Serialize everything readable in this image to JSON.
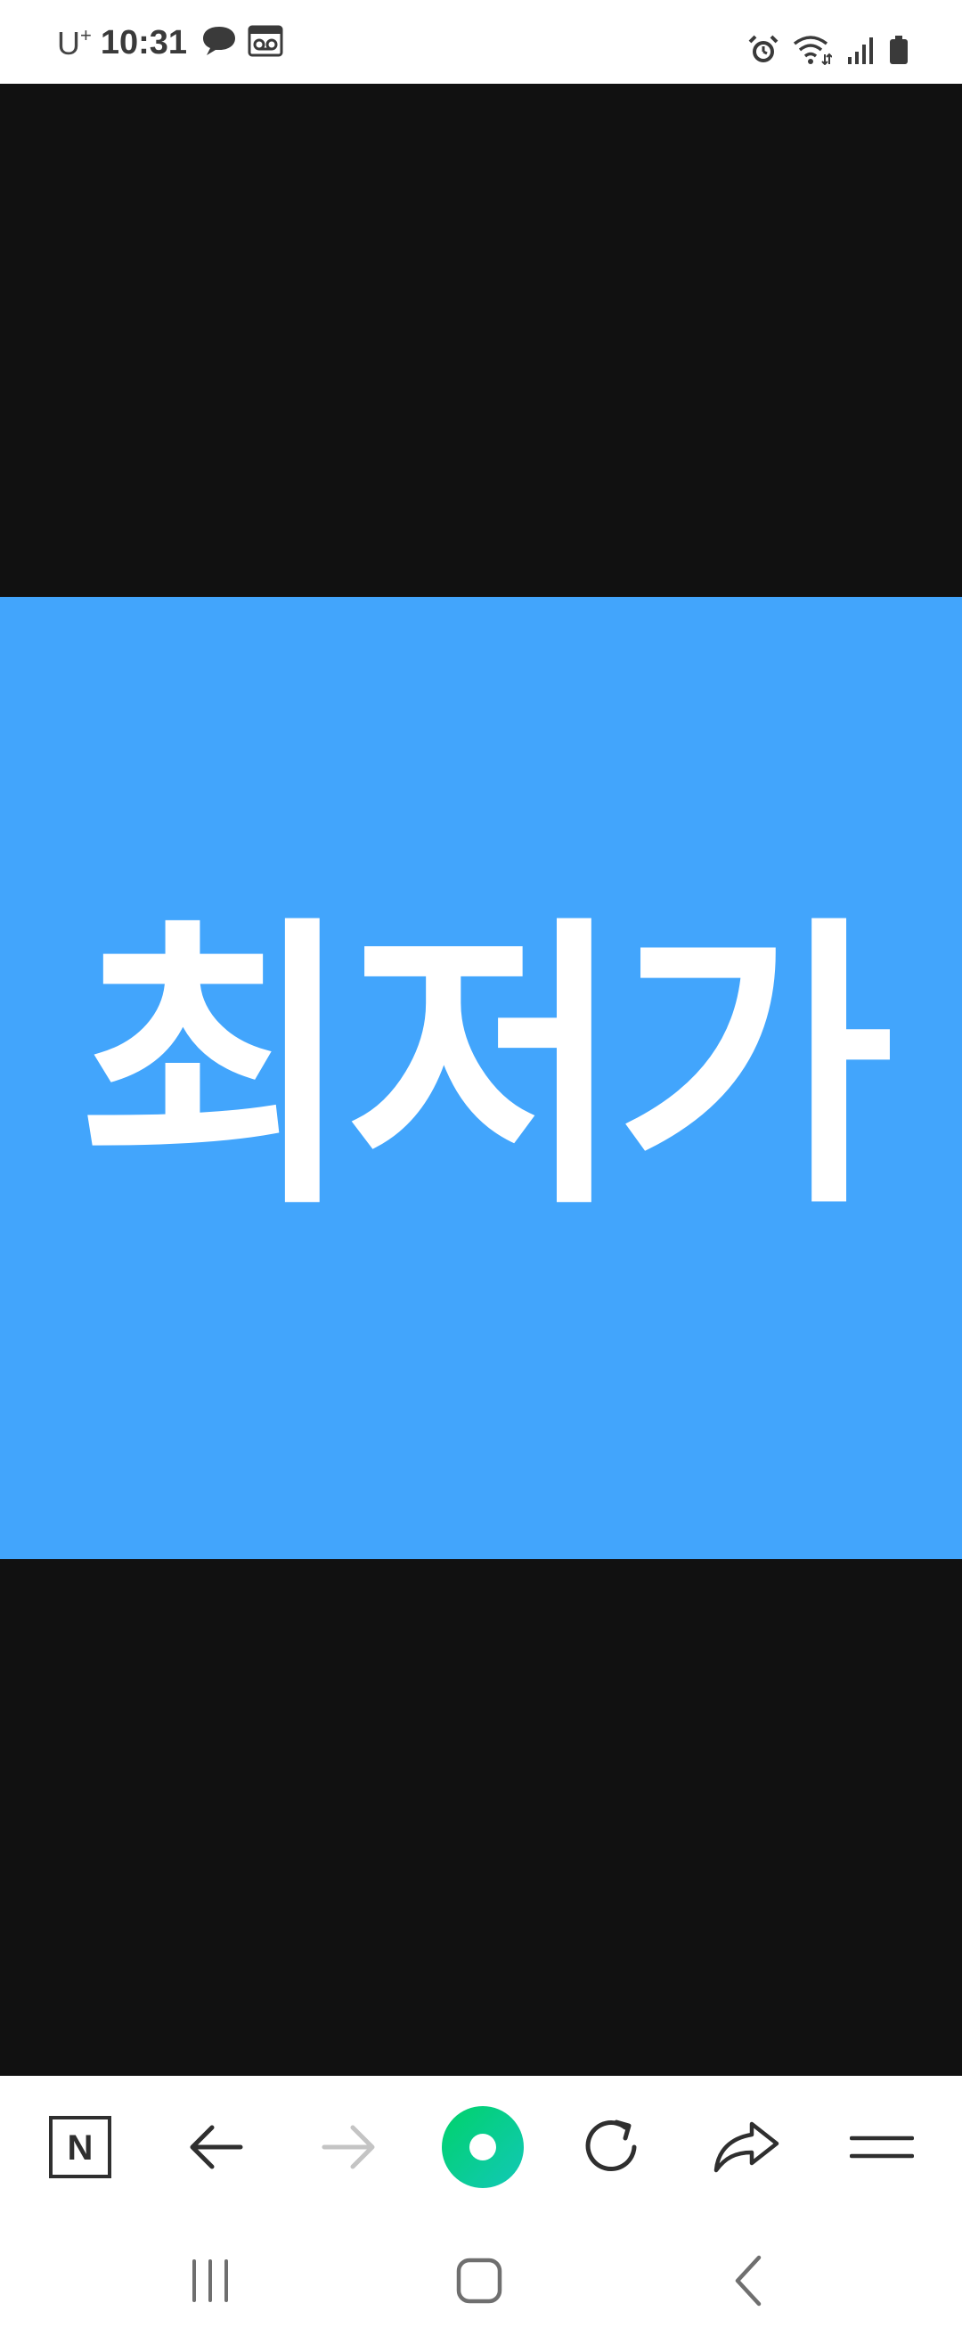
{
  "status_bar": {
    "carrier": "U",
    "carrier_sup": "+",
    "time": "10:31",
    "left_icons": [
      "talk-bubble-icon",
      "voicemail-icon"
    ],
    "right_icons": [
      "alarm-icon",
      "wifi-icon",
      "signal-icon",
      "battery-icon"
    ]
  },
  "image": {
    "text": "최저가",
    "background": "#42a5fc",
    "text_color": "#ffffff"
  },
  "toolbar": {
    "buttons": [
      "naver-home",
      "back",
      "forward",
      "green-dot",
      "reload",
      "share",
      "menu"
    ],
    "naver_label": "N",
    "accent": "#03c75a",
    "forward_disabled": true
  },
  "system_nav": {
    "buttons": [
      "recent-apps",
      "home",
      "back"
    ]
  }
}
